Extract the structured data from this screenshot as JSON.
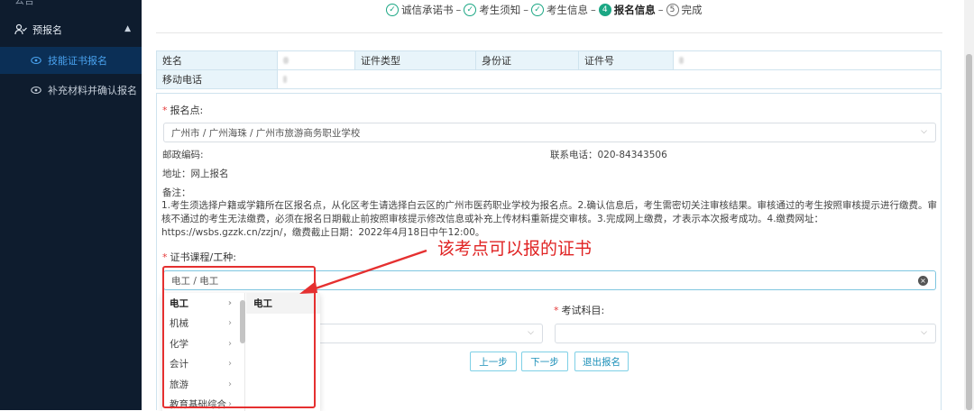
{
  "sidebar": {
    "top_clipped": "公告",
    "group": {
      "label": "预报名",
      "icon": "user-group-icon",
      "caret": "chevron-up-icon"
    },
    "items": [
      {
        "label": "技能证书报名",
        "icon": "eye-icon",
        "active": true
      },
      {
        "label": "补充材料并确认报名",
        "icon": "eye-icon",
        "active": false
      }
    ]
  },
  "steps": [
    {
      "label": "诚信承诺书",
      "mark": "✓",
      "state": "done"
    },
    {
      "label": "考生须知",
      "mark": "✓",
      "state": "done"
    },
    {
      "label": "考生信息",
      "mark": "✓",
      "state": "done"
    },
    {
      "label": "报名信息",
      "mark": "4",
      "state": "current"
    },
    {
      "label": "完成",
      "mark": "5",
      "state": "todo"
    }
  ],
  "step_separator": "–",
  "info": {
    "name_label": "姓名",
    "idtype_label": "证件类型",
    "idtype_value": "身份证",
    "idno_label": "证件号",
    "phone_label": "移动电话"
  },
  "form": {
    "site_label": "报名点:",
    "site_value": "广州市 / 广州海珠 / 广州市旅游商务职业学校",
    "postcode_label": "邮政编码:",
    "contact_phone": "联系电话：020-84343506",
    "address": "地址：网上报名",
    "remark_label": "备注：",
    "remark_text": "1.考生须选择户籍或学籍所在区报名点，从化区考生请选择白云区的广州市医药职业学校为报名点。2.确认信息后，考生需密切关注审核结果。审核通过的考生按照审核提示进行缴费。审核不通过的考生无法缴费，必须在报名日期截止前按照审核提示修改信息或补充上传材料重新提交审核。3.完成网上缴费，才表示本次报考成功。4.缴费网址：https://wsbs.gzzk.cn/zzjn/，缴费截止日期：2022年4月18日中午12:00。",
    "course_label": "证书课程/工种:",
    "course_value": "电工 / 电工",
    "subject_label": "考试科目:"
  },
  "cascader": {
    "col1": [
      {
        "label": "电工",
        "selected": true
      },
      {
        "label": "机械",
        "selected": false
      },
      {
        "label": "化学",
        "selected": false
      },
      {
        "label": "会计",
        "selected": false
      },
      {
        "label": "旅游",
        "selected": false
      },
      {
        "label": "教育基础综合",
        "selected": false
      }
    ],
    "col2": [
      {
        "label": "电工",
        "selected": true
      }
    ]
  },
  "annotation": "该考点可以报的证书",
  "buttons": {
    "prev": "上一步",
    "next": "下一步",
    "exit": "退出报名"
  },
  "colors": {
    "accent": "#1ba784",
    "sidebar_bg": "#0e1c2e",
    "link": "#4aa3f0",
    "annotation": "#e02424"
  }
}
